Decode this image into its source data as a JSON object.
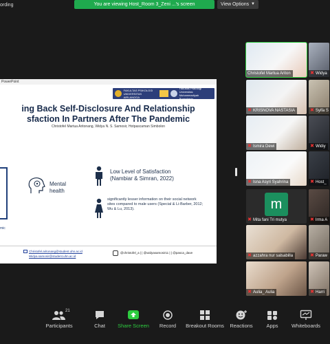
{
  "window": {
    "recording_label": "ording",
    "viewing_banner": "You are viewing Host_Room 3_Zeni ...'s screen",
    "view_options": "View Options"
  },
  "slide": {
    "app_label": "PowerPoint",
    "logo_text_1": "FAKULTAS PSIKOLOGI",
    "logo_text_2": "UNIVERSITAS AIRLANGGA",
    "logo_text_3": "Fakultas Psikologi Universitas Muhammadiyah Purwokerto",
    "title_line1": "ing Back Self-Disclosure And Relationship",
    "title_line2": "sfaction In Partners After The Pandemic",
    "authors": "Christofel Martua Aritonang, Widya N. S. Samosir, Hotpascaman Simbolon",
    "left_fragment": "mic",
    "mental_label_1": "Mental",
    "mental_label_2": "health",
    "satisfaction_title_1": "Low Level of Satisfaction",
    "satisfaction_title_2": "(Nambiar & Simran, 2022)",
    "satisfaction_body": "significantly lesser information on their social network sites compared to male users (Special & Li-Barber, 2012; Wu & Lu, 2013).",
    "email_1": "Christofel.aritonang@student.uhn.ac.id",
    "email_2": "Widya.samosir@student.uhn.ac.id",
    "handles": "@christofel_a  |  |  @widyasamosir11  |  |  @pasca_dave",
    "colors": {
      "title": "#16294a",
      "accent": "#1f3f7a",
      "logo_bar": "#2c3e7a"
    }
  },
  "gallery": {
    "tiles": [
      {
        "name": "Christofel Martua Ariton",
        "muted": false
      },
      {
        "name": "Widya",
        "muted": true
      },
      {
        "name": "KRISNOVA NASTASIA",
        "muted": true
      },
      {
        "name": "Syifa S",
        "muted": true
      },
      {
        "name": "Ismira Dewi",
        "muted": true
      },
      {
        "name": "Widiy",
        "muted": true
      },
      {
        "name": "Isna Asyri Syahrina",
        "muted": true
      },
      {
        "name": "Host_",
        "muted": true
      },
      {
        "name": "Mita fani Tri mutya",
        "muted": true,
        "initial": "m"
      },
      {
        "name": "Irma A",
        "muted": true
      },
      {
        "name": "azzahra nur salsabilla",
        "muted": true
      },
      {
        "name": "Paraw",
        "muted": true
      },
      {
        "name": "Aulia_ Aulia",
        "muted": true
      },
      {
        "name": "Harri",
        "muted": true
      }
    ]
  },
  "toolbar": {
    "participants_label": "Participants",
    "participants_count": "21",
    "chat_label": "Chat",
    "share_label": "Share Screen",
    "record_label": "Record",
    "breakout_label": "Breakout Rooms",
    "reactions_label": "Reactions",
    "apps_label": "Apps",
    "whiteboards_label": "Whiteboards"
  }
}
